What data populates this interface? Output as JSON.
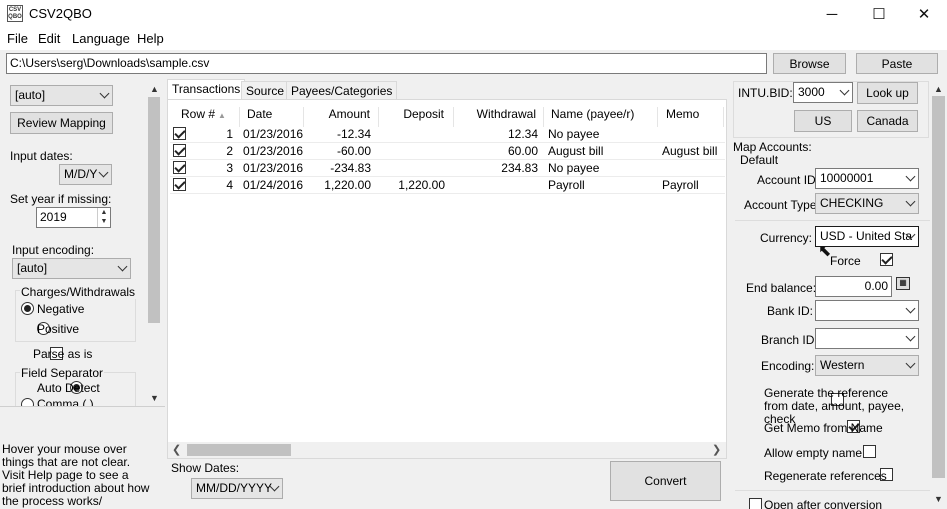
{
  "window": {
    "title": "CSV2QBO",
    "minimize": "─",
    "maximize": "☐",
    "close": "✕"
  },
  "menu": [
    "File",
    "Edit",
    "Language",
    "Help"
  ],
  "file_bar": {
    "path": "C:\\Users\\serg\\Downloads\\sample.csv",
    "browse": "Browse",
    "paste": "Paste"
  },
  "left": {
    "mapping_select": "[auto]",
    "review_mapping": "Review Mapping",
    "input_dates_label": "Input dates:",
    "input_dates_value": "M/D/Y",
    "set_year_label": "Set year if missing:",
    "set_year_value": "2019",
    "input_encoding_label": "Input encoding:",
    "input_encoding_value": "[auto]",
    "charges_group": "Charges/Withdrawals",
    "negative": "Negative",
    "positive": "Positive",
    "parse_as_is": "Parse as is",
    "field_separator": "Field Separator",
    "auto_detect": "Auto Detect",
    "comma": "Comma (,)",
    "help_text": "Hover your mouse over things that are not clear. Visit Help page to see a brief introduction about how the process works/"
  },
  "tabs": [
    "Transactions",
    "Source",
    "Payees/Categories"
  ],
  "table": {
    "headers": [
      "Row #",
      "Date",
      "Amount",
      "Deposit",
      "Withdrawal",
      "Name (payee/r)",
      "Memo"
    ],
    "rows": [
      {
        "row": "1",
        "date": "01/23/2016",
        "amount": "-12.34",
        "deposit": "",
        "withdrawal": "12.34",
        "name": "No payee",
        "memo": ""
      },
      {
        "row": "2",
        "date": "01/23/2016",
        "amount": "-60.00",
        "deposit": "",
        "withdrawal": "60.00",
        "name": "August bill",
        "memo": "August bill"
      },
      {
        "row": "3",
        "date": "01/23/2016",
        "amount": "-234.83",
        "deposit": "",
        "withdrawal": "234.83",
        "name": "No payee",
        "memo": ""
      },
      {
        "row": "4",
        "date": "01/24/2016",
        "amount": "1,220.00",
        "deposit": "1,220.00",
        "withdrawal": "",
        "name": "Payroll",
        "memo": "Payroll"
      }
    ]
  },
  "bottom": {
    "show_dates_label": "Show Dates:",
    "show_dates_value": "MM/DD/YYYY",
    "convert": "Convert"
  },
  "right": {
    "intu_bid_label": "INTU.BID:",
    "intu_bid_value": "3000",
    "look_up": "Look up",
    "us": "US",
    "canada": "Canada",
    "map_accounts": "Map Accounts:",
    "default": "Default",
    "account_id_label": "Account ID:",
    "account_id_value": "10000001",
    "account_type_label": "Account Type:",
    "account_type_value": "CHECKING",
    "currency_label": "Currency:",
    "currency_value": "USD - United Sta",
    "force": "Force",
    "end_balance_label": "End balance:",
    "end_balance_value": "0.00",
    "bank_id_label": "Bank ID:",
    "branch_id_label": "Branch ID",
    "encoding_label": "Encoding:",
    "encoding_value": "Western",
    "generate_ref": "Generate the reference from date, amount, payee, check",
    "get_memo": "Get Memo from Name",
    "allow_empty": "Allow empty name",
    "regenerate": "Regenerate references",
    "open_after": "Open after conversion"
  }
}
